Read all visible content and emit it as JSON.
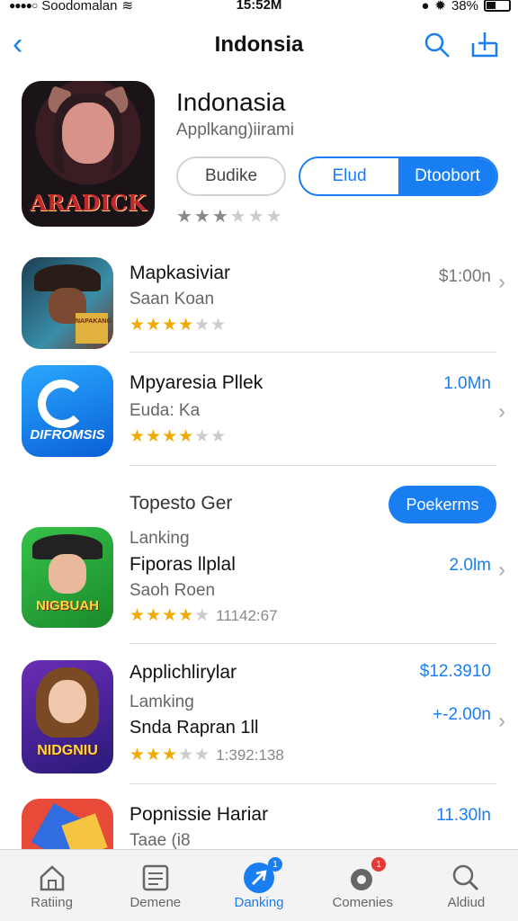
{
  "status": {
    "carrier": "Soodomalan",
    "time": "15:52M",
    "battery": "38%"
  },
  "nav": {
    "title": "Indonsia",
    "back_icon": "chevron-left-icon",
    "search_icon": "search-icon",
    "share_icon": "share-icon"
  },
  "hero": {
    "art_text": "ARADICK",
    "name": "Indonasia",
    "subtitle": "Applkang)iirami",
    "button_left": "Budike",
    "segment_left": "Elud",
    "segment_right": "Dtoobort",
    "rating": 2.5
  },
  "rows": [
    {
      "name": "Mapkasiviar",
      "sub": "Saan Koan",
      "stars": 3.5,
      "price": "$1:00n",
      "art_text": "NAPAKANG"
    },
    {
      "name": "Mpyaresia Pllek",
      "sub": "Euda: Ka",
      "stars": 4,
      "price": "1.0Mn",
      "art_text": "DIFROMSIS"
    },
    {
      "section": "Topesto Ger",
      "pill": "Poekerms",
      "label": "Lanking",
      "name": "Fiporas llplal",
      "sub": "Saoh Roen",
      "stars": 4,
      "count": "11142:67",
      "price": "2.0lm",
      "art_text": "NIGBUAH"
    },
    {
      "name": "Applichlirylar",
      "price_top": "$12.3910",
      "label": "Lamking",
      "sub": "Snda Rapran 1ll",
      "stars": 3,
      "count": "1:392:138",
      "price": "+-2.00n",
      "art_text": "NIDGNIU"
    },
    {
      "name": "Popnissie Hariar",
      "sub": "Taae (i8",
      "price": "11.30ln"
    }
  ],
  "tabs": [
    {
      "label": "Ratiing",
      "icon": "home-icon"
    },
    {
      "label": "Demene",
      "icon": "list-icon"
    },
    {
      "label": "Danking",
      "icon": "compass-icon",
      "badge": "1"
    },
    {
      "label": "Comenies",
      "icon": "chat-icon",
      "badge": "1"
    },
    {
      "label": "Aldiud",
      "icon": "search-icon"
    }
  ]
}
